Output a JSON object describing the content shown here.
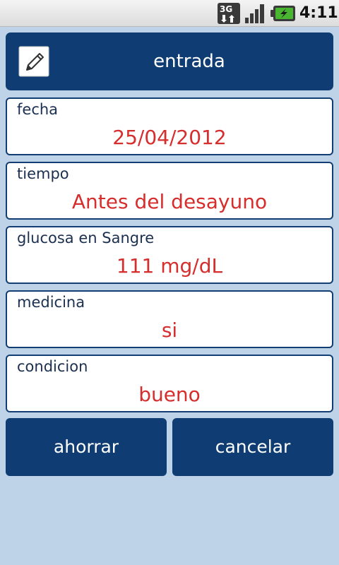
{
  "status_bar": {
    "network_icon": "3g-data-icon",
    "signal_icon": "signal-strength-icon",
    "battery_icon": "battery-charging-icon",
    "time": "4:11"
  },
  "header": {
    "icon": "edit-icon",
    "title": "entrada"
  },
  "fields": [
    {
      "label": "fecha",
      "value": "25/04/2012"
    },
    {
      "label": "tiempo",
      "value": "Antes del desayuno"
    },
    {
      "label": "glucosa en Sangre",
      "value": "111 mg/dL"
    },
    {
      "label": "medicina",
      "value": "si"
    },
    {
      "label": "condicion",
      "value": "bueno"
    }
  ],
  "actions": {
    "save_label": "ahorrar",
    "cancel_label": "cancelar"
  },
  "colors": {
    "background": "#bed3e8",
    "primary": "#0f3d73",
    "value_text": "#d62d2d",
    "label_text": "#1b3050"
  }
}
